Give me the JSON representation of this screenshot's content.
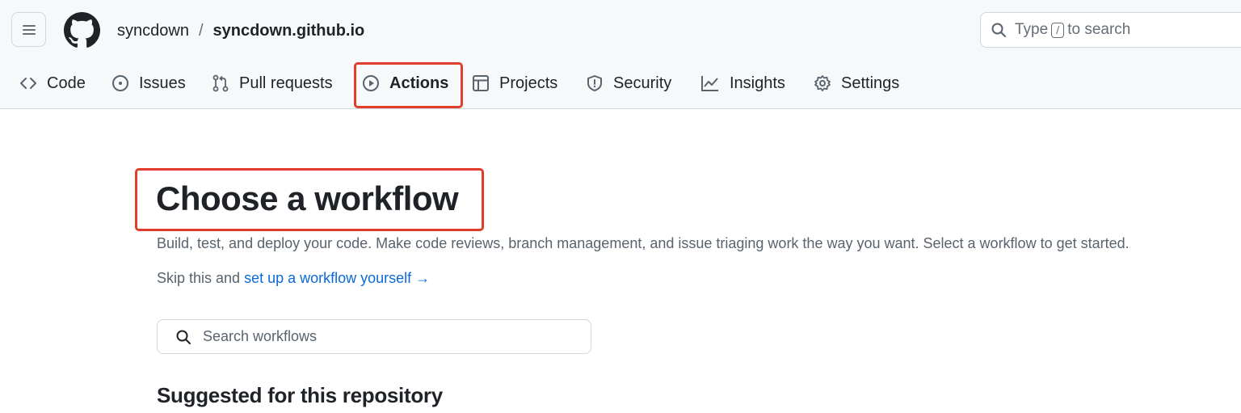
{
  "header": {
    "owner": "syncdown",
    "separator": "/",
    "repo": "syncdown.github.io",
    "search": {
      "prefix": "Type",
      "key": "/",
      "suffix": "to search"
    }
  },
  "nav": {
    "tabs": [
      {
        "label": "Code",
        "icon": "code-icon"
      },
      {
        "label": "Issues",
        "icon": "issue-icon"
      },
      {
        "label": "Pull requests",
        "icon": "pull-request-icon"
      },
      {
        "label": "Actions",
        "icon": "play-icon",
        "active": true
      },
      {
        "label": "Projects",
        "icon": "table-icon"
      },
      {
        "label": "Security",
        "icon": "shield-icon"
      },
      {
        "label": "Insights",
        "icon": "graph-icon"
      },
      {
        "label": "Settings",
        "icon": "gear-icon"
      }
    ]
  },
  "main": {
    "title": "Choose a workflow",
    "description": "Build, test, and deploy your code. Make code reviews, branch management, and issue triaging work the way you want. Select a workflow to get started.",
    "skip_prefix": "Skip this and",
    "skip_link": "set up a workflow yourself →",
    "search_placeholder": "Search workflows",
    "suggested_heading": "Suggested for this repository"
  },
  "colors": {
    "highlight": "#e03d2a",
    "link": "#0969da",
    "header_bg": "#f6f8fa"
  }
}
